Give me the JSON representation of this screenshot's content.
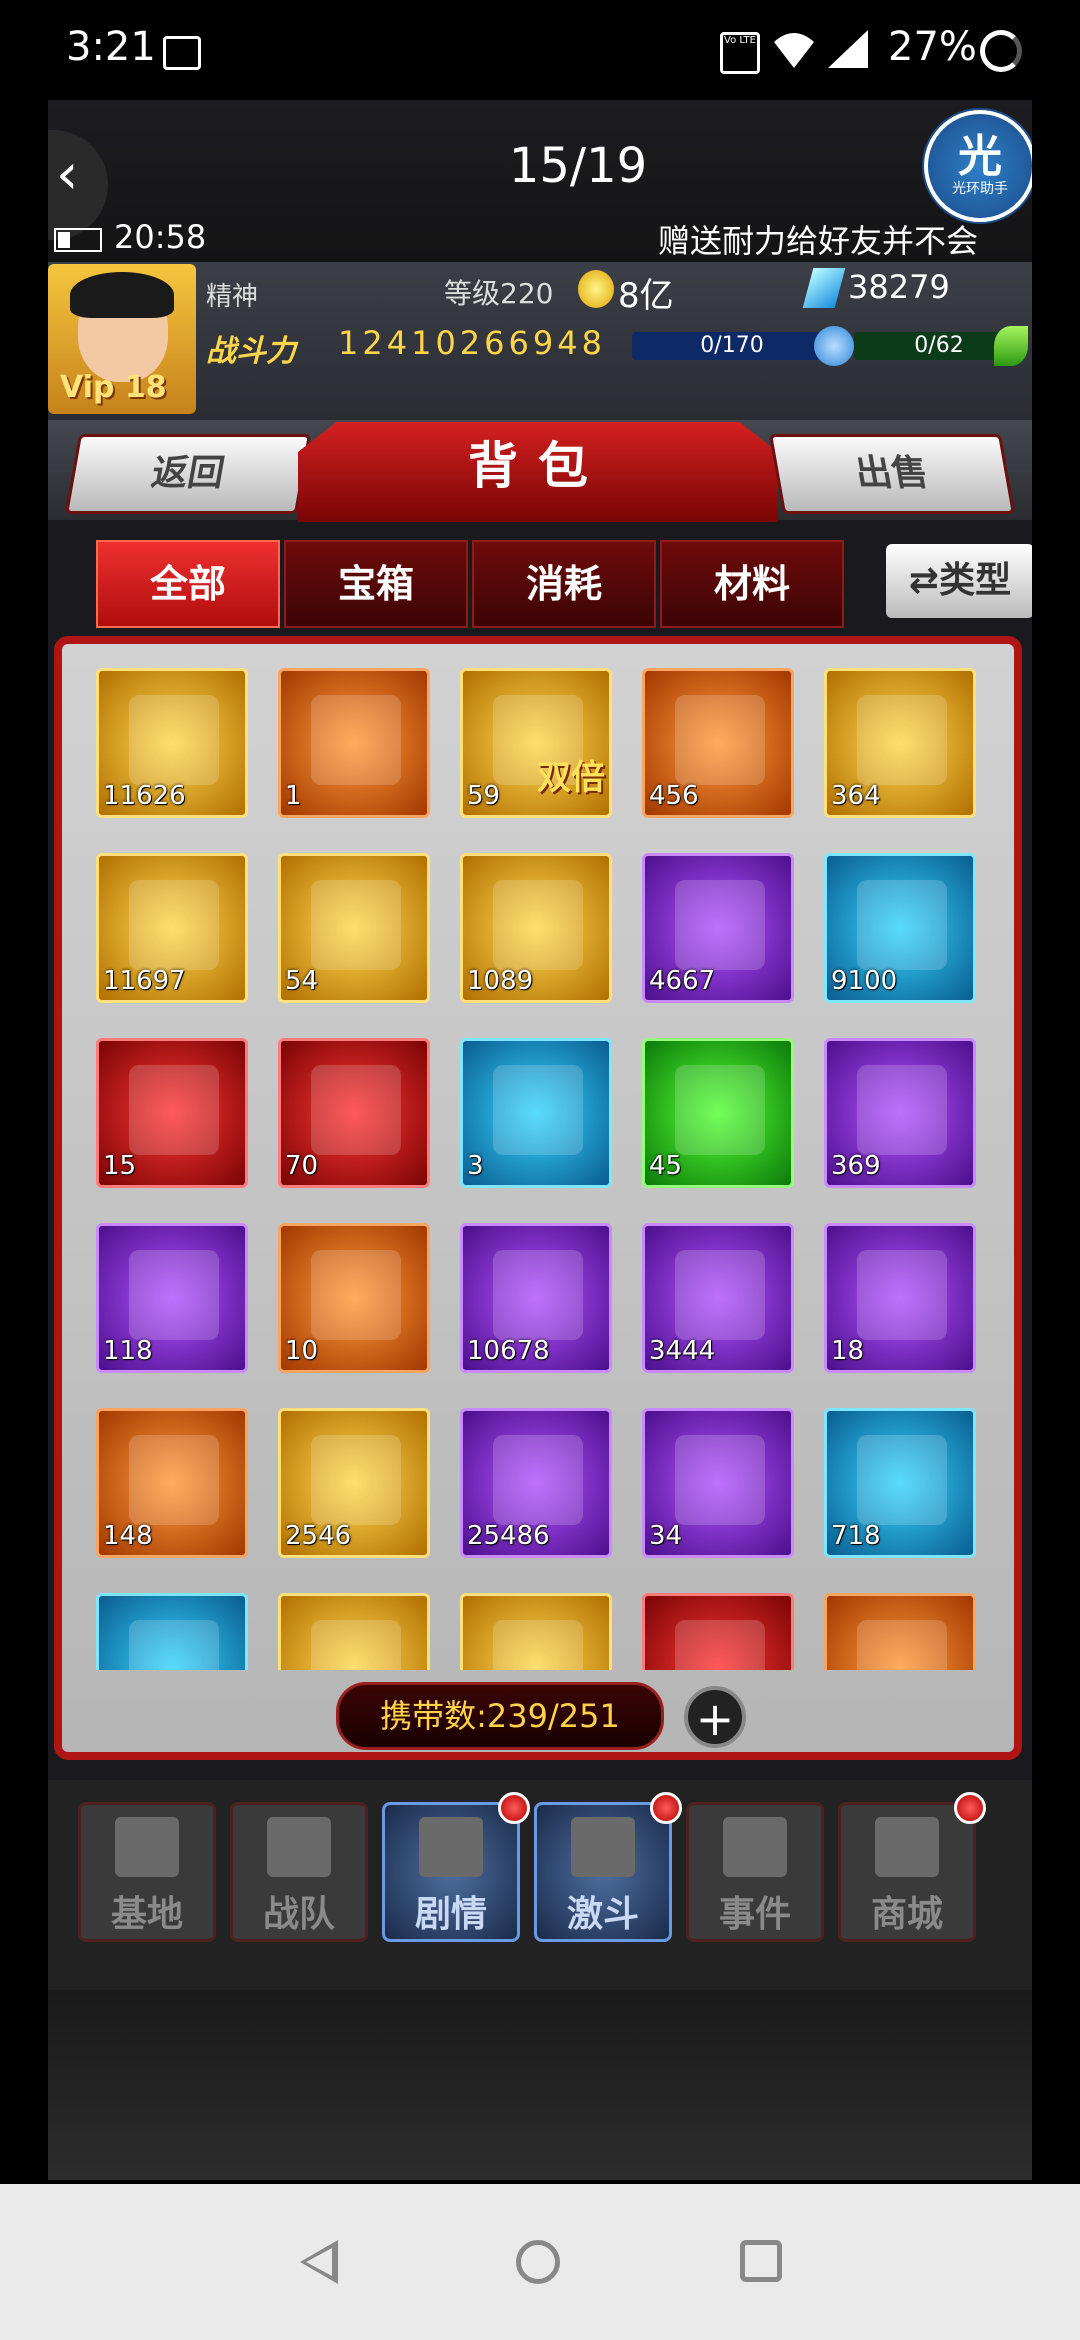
{
  "status_bar": {
    "time": "3:21",
    "battery": "27%",
    "volte": "Vo LTE"
  },
  "game_top": {
    "pager": "15/19",
    "helper_glyph": "光",
    "helper_label": "光环助手"
  },
  "game_clock": "20:58",
  "marquee": "赠送耐力给好友并不会",
  "player": {
    "name": "精神",
    "level": "等级220",
    "gold": "8亿",
    "gems": "38279",
    "vip": "Vip 18",
    "power_label": "战斗力",
    "power_value": "12410266948",
    "stamina": "0/170",
    "energy": "0/62"
  },
  "nav": {
    "back": "返回",
    "title": "背包",
    "sell": "出售"
  },
  "tabs": [
    "全部",
    "宝箱",
    "消耗",
    "材料"
  ],
  "type_button": "⇄类型",
  "items": [
    {
      "count": "11626",
      "rarity": "gold"
    },
    {
      "count": "1",
      "rarity": "orange"
    },
    {
      "count": "59",
      "rarity": "gold",
      "badge": "双倍"
    },
    {
      "count": "456",
      "rarity": "orange"
    },
    {
      "count": "364",
      "rarity": "gold"
    },
    {
      "count": "11697",
      "rarity": "gold"
    },
    {
      "count": "54",
      "rarity": "gold"
    },
    {
      "count": "1089",
      "rarity": "gold"
    },
    {
      "count": "4667",
      "rarity": "purple"
    },
    {
      "count": "9100",
      "rarity": "blue"
    },
    {
      "count": "15",
      "rarity": "red"
    },
    {
      "count": "70",
      "rarity": "red"
    },
    {
      "count": "3",
      "rarity": "blue"
    },
    {
      "count": "45",
      "rarity": "green"
    },
    {
      "count": "369",
      "rarity": "purple"
    },
    {
      "count": "118",
      "rarity": "purple"
    },
    {
      "count": "10",
      "rarity": "orange"
    },
    {
      "count": "10678",
      "rarity": "purple"
    },
    {
      "count": "3444",
      "rarity": "purple"
    },
    {
      "count": "18",
      "rarity": "purple"
    },
    {
      "count": "148",
      "rarity": "orange"
    },
    {
      "count": "2546",
      "rarity": "gold"
    },
    {
      "count": "25486",
      "rarity": "purple"
    },
    {
      "count": "34",
      "rarity": "purple"
    },
    {
      "count": "718",
      "rarity": "blue"
    },
    {
      "count": "",
      "rarity": "blue"
    },
    {
      "count": "",
      "rarity": "gold"
    },
    {
      "count": "",
      "rarity": "gold"
    },
    {
      "count": "",
      "rarity": "red"
    },
    {
      "count": "",
      "rarity": "orange"
    }
  ],
  "carry": "携带数:239/251",
  "bottom_nav": [
    {
      "label": "基地",
      "active": false,
      "dot": false
    },
    {
      "label": "战队",
      "active": false,
      "dot": false
    },
    {
      "label": "剧情",
      "active": true,
      "dot": true
    },
    {
      "label": "激斗",
      "active": true,
      "dot": true
    },
    {
      "label": "事件",
      "active": false,
      "dot": false
    },
    {
      "label": "商城",
      "active": false,
      "dot": true
    }
  ]
}
